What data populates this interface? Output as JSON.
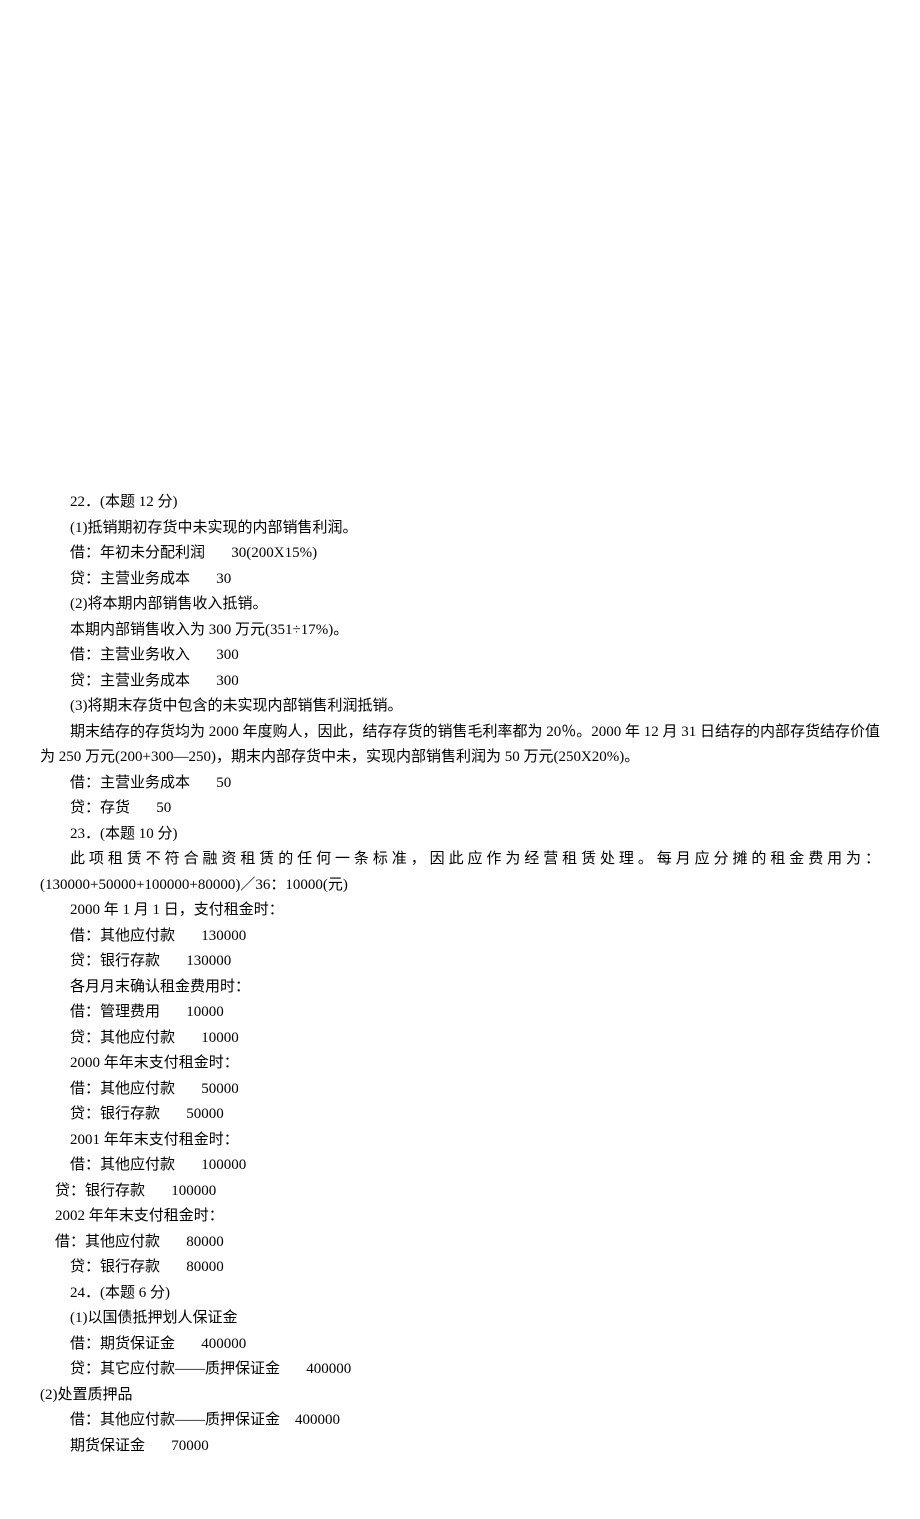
{
  "lines": [
    {
      "cls": "para",
      "text": "22．(本题 12 分)"
    },
    {
      "cls": "para",
      "text": "(1)抵销期初存货中未实现的内部销售利润。"
    },
    {
      "cls": "para",
      "text": "借：年初未分配利润       30(200X15%)"
    },
    {
      "cls": "para",
      "text": "贷：主营业务成本       30"
    },
    {
      "cls": "para",
      "text": "(2)将本期内部销售收入抵销。"
    },
    {
      "cls": "para",
      "text": "本期内部销售收入为 300 万元(351÷17%)。"
    },
    {
      "cls": "para",
      "text": "借：主营业务收入       300"
    },
    {
      "cls": "para",
      "text": "贷：主营业务成本       300"
    },
    {
      "cls": "para",
      "text": "(3)将期末存货中包含的未实现内部销售利润抵销。"
    },
    {
      "cls": "para",
      "text": "期末结存的存货均为 2000 年度购人，因此，结存存货的销售毛利率都为 20％。2000 年 12 月 31 日结存的内部存货结存价值为 250 万元(200+300—250)，期末内部存货中未，实现内部销售利润为 50 万元(250X20%)。"
    },
    {
      "cls": "para",
      "text": "借：主营业务成本       50"
    },
    {
      "cls": "para",
      "text": "贷：存货       50"
    },
    {
      "cls": "para",
      "text": "23．(本题 10 分)"
    },
    {
      "cls": "para justify-dist",
      "text": "此项租赁不符合融资租赁的任何一条标准，因此应作为经营租赁处理。每月应分摊的租金费用为："
    },
    {
      "cls": "para-left0",
      "text": "(130000+50000+100000+80000)／36：10000(元)"
    },
    {
      "cls": "para",
      "text": "2000 年 1 月 1 日，支付租金时："
    },
    {
      "cls": "para",
      "text": "借：其他应付款       130000"
    },
    {
      "cls": "para",
      "text": "贷：银行存款       130000"
    },
    {
      "cls": "para",
      "text": "各月月末确认租金费用时："
    },
    {
      "cls": "para",
      "text": "借：管理费用       10000"
    },
    {
      "cls": "para",
      "text": "贷：其他应付款       10000"
    },
    {
      "cls": "para",
      "text": "2000 年年末支付租金时："
    },
    {
      "cls": "para",
      "text": "借：其他应付款       50000"
    },
    {
      "cls": "para",
      "text": "贷：银行存款       50000"
    },
    {
      "cls": "para",
      "text": "2001 年年末支付租金时："
    },
    {
      "cls": "para",
      "text": "借：其他应付款       100000"
    },
    {
      "cls": "para-flush",
      "text": "贷：银行存款       100000"
    },
    {
      "cls": "para-flush",
      "text": "2002 年年末支付租金时："
    },
    {
      "cls": "para-flush",
      "text": "借：其他应付款       80000"
    },
    {
      "cls": "para",
      "text": "贷：银行存款       80000"
    },
    {
      "cls": "para",
      "text": "24．(本题 6 分)"
    },
    {
      "cls": "para",
      "text": "(1)以国债抵押划人保证金"
    },
    {
      "cls": "para",
      "text": "借：期货保证金       400000"
    },
    {
      "cls": "para",
      "text": "贷：其它应付款——质押保证金       400000"
    },
    {
      "cls": "para-left0",
      "text": "(2)处置质押品"
    },
    {
      "cls": "para",
      "text": "借：其他应付款——质押保证金    400000"
    },
    {
      "cls": "para",
      "text": "期货保证金       70000"
    }
  ]
}
